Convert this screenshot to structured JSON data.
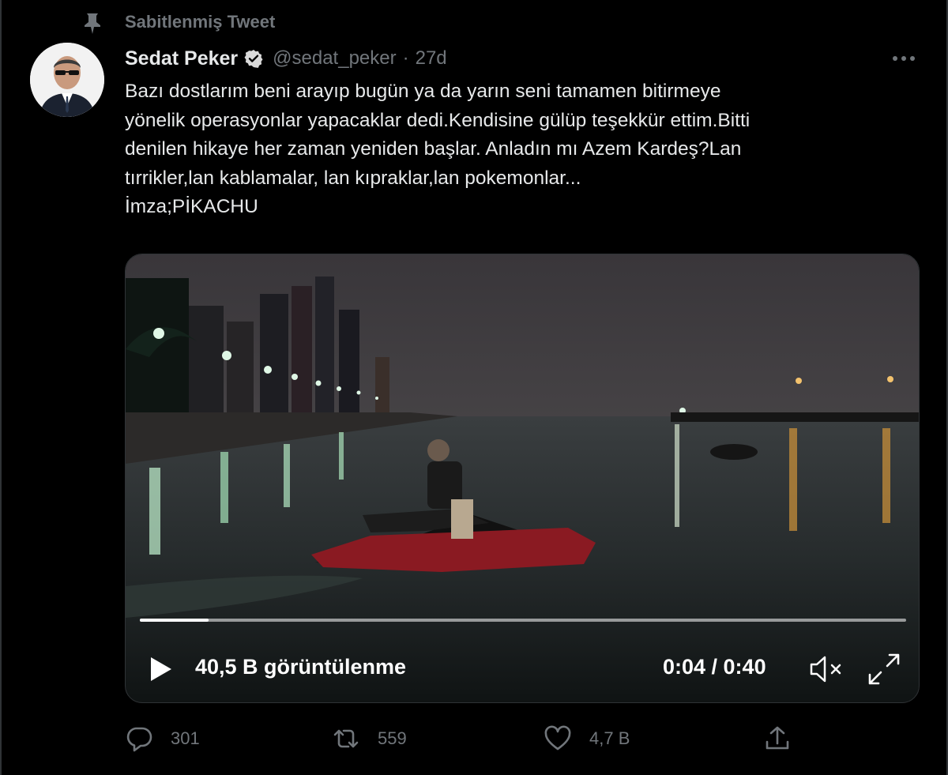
{
  "pinned": {
    "label": "Sabitlenmiş Tweet",
    "icon": "pin-icon"
  },
  "author": {
    "display_name": "Sedat Peker",
    "handle": "@sedat_peker",
    "verified_icon": "verified-badge-icon",
    "avatar_icon": "avatar"
  },
  "tweet": {
    "separator": "·",
    "time": "27d",
    "text": "Bazı dostlarım beni arayıp bugün ya da  yarın seni tamamen bitirmeye\nyönelik operasyonlar yapacaklar dedi.Kendisine gülüp teşekkür ettim.Bitti\ndenilen hikaye her zaman yeniden başlar. Anladın mı Azem Kardeş?Lan\ntırrikler,lan kablamalar, lan kıpraklar,lan pokemonlar...\nİmza;PİKACHU"
  },
  "video": {
    "views": "40,5 B görüntülenme",
    "time_readout": "0:04 / 0:40",
    "progress": 0.09,
    "icons": [
      "play-icon",
      "mute-icon",
      "fullscreen-icon"
    ]
  },
  "actions": {
    "reply_count": "301",
    "retweet_count": "559",
    "like_count": "4,7 B",
    "icons": [
      "reply-icon",
      "retweet-icon",
      "like-icon",
      "share-icon"
    ]
  },
  "colors": {
    "background": "#000000",
    "text_primary": "#e7e9ea",
    "text_secondary": "#71767b",
    "verified": "#d9d9d9"
  }
}
